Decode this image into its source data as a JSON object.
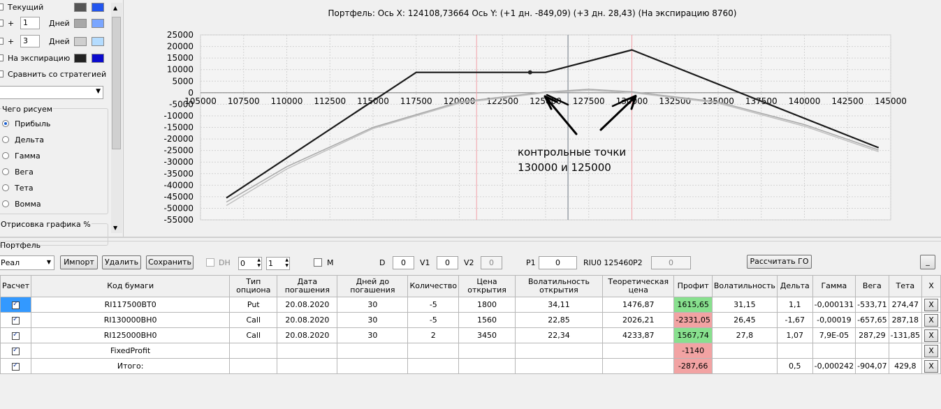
{
  "left_panel": {
    "rows": [
      {
        "label": "Текущий"
      },
      {
        "plus": "+",
        "value": "1",
        "unit": "Дней"
      },
      {
        "plus": "+",
        "value": "3",
        "unit": "Дней"
      },
      {
        "label": "На экспирацию"
      }
    ],
    "compare_label": "Сравнить со стратегией",
    "what_group": "Чего рисуем",
    "options": [
      "Прибыль",
      "Дельта",
      "Гамма",
      "Вега",
      "Тета",
      "Вомма"
    ],
    "selected_option": "Прибыль",
    "draw_group": "Отрисовка графика %",
    "colors": {
      "current_a": "#555555",
      "current_b": "#2255ee",
      "day1_a": "#a8a8a8",
      "day1_b": "#7aa6ff",
      "day3_a": "#cfcfcf",
      "day3_b": "#b4dcff",
      "exp_a": "#222222",
      "exp_b": "#0a0acc"
    }
  },
  "chart": {
    "header": "Портфель: Ось X: 124108,73664 Ось Y:  (+1 дн. -849,09)  (+3 дн. 28,43)  (На экспирацию 8760)",
    "annotation_line1": "контрольные точки",
    "annotation_line2": "130000 и 125000"
  },
  "chart_data": {
    "type": "line",
    "xlim": [
      105000,
      145000
    ],
    "ylim": [
      -55000,
      25000
    ],
    "x_ticks": [
      "105000",
      "107500",
      "110000",
      "112500",
      "115000",
      "117500",
      "120000",
      "122500",
      "125000",
      "127500",
      "130000",
      "132500",
      "135000",
      "137500",
      "140000",
      "142500",
      "145000"
    ],
    "y_ticks": [
      "25000",
      "20000",
      "15000",
      "10000",
      "5000",
      "0",
      "-5000",
      "-10000",
      "-15000",
      "-20000",
      "-25000",
      "-30000",
      "-35000",
      "-40000",
      "-45000",
      "-50000",
      "-55000"
    ],
    "series": [
      {
        "color": "#1a1a1a",
        "x": [
          106500,
          117500,
          124000,
          125000,
          130000,
          144300
        ],
        "y": [
          -45500,
          8800,
          8800,
          8800,
          18500,
          -23800
        ]
      },
      {
        "color": "#c0c0c0",
        "x": [
          106500,
          110000,
          115000,
          120000,
          125000,
          127500,
          130000,
          135000,
          140000,
          144300
        ],
        "y": [
          -48800,
          -33000,
          -15500,
          -4500,
          0,
          1000,
          0,
          -4500,
          -14500,
          -25500
        ]
      },
      {
        "color": "#a8a8a8",
        "x": [
          106500,
          110000,
          115000,
          120000,
          125000,
          127500,
          130000,
          135000,
          140000,
          144300
        ],
        "y": [
          -47300,
          -32000,
          -15000,
          -4000,
          300,
          1500,
          400,
          -4000,
          -13800,
          -24800
        ]
      }
    ],
    "marker": {
      "x": 124100,
      "y": 8800
    },
    "vlines_pink": [
      121000,
      130000
    ],
    "vline_cursor": 126300
  },
  "portfolio": {
    "label": "Портфель",
    "dropdown_value": "Реал",
    "buttons": {
      "import": "Импорт",
      "delete": "Удалить",
      "save": "Сохранить",
      "calc": "Рассчитать ГО",
      "min": "_"
    },
    "dh_label": "DH",
    "spin1": "0",
    "spin2": "1",
    "m_label": "M",
    "d_label": "D",
    "d_value": "0",
    "v1_label": "V1",
    "v1_value": "0",
    "v2_label": "V2",
    "v2_value": "0",
    "p1_label": "P1",
    "p1_value": "0",
    "riu_text": "RIU0 125460",
    "p2_label": "P2",
    "p2_value": "0"
  },
  "table": {
    "headers": [
      "Расчет",
      "Код бумаги",
      "Тип опциона",
      "Дата погашения",
      "Дней до погашения",
      "Количество",
      "Цена открытия",
      "Волатильность открытия",
      "Теоретическая цена",
      "Профит",
      "Волатильность",
      "Дельта",
      "Гамма",
      "Вега",
      "Тета",
      "X"
    ],
    "rows": [
      {
        "code": "RI117500BT0",
        "type": "Put",
        "date": "20.08.2020",
        "days": "30",
        "qty": "-5",
        "open": "1800",
        "vol_open": "34,11",
        "theo": "1476,87",
        "profit": "1615,65",
        "pcls": "g",
        "vol": "31,15",
        "delta": "1,1",
        "gamma": "-0,000131",
        "vega": "-533,71",
        "theta": "274,47",
        "x": "X"
      },
      {
        "code": "RI130000BH0",
        "type": "Call",
        "date": "20.08.2020",
        "days": "30",
        "qty": "-5",
        "open": "1560",
        "vol_open": "22,85",
        "theo": "2026,21",
        "profit": "-2331,05",
        "pcls": "r",
        "vol": "26,45",
        "delta": "-1,67",
        "gamma": "-0,00019",
        "vega": "-657,65",
        "theta": "287,18",
        "x": "X"
      },
      {
        "code": "RI125000BH0",
        "type": "Call",
        "date": "20.08.2020",
        "days": "30",
        "qty": "2",
        "open": "3450",
        "vol_open": "22,34",
        "theo": "4233,87",
        "profit": "1567,74",
        "pcls": "g",
        "vol": "27,8",
        "delta": "1,07",
        "gamma": "7,9E-05",
        "vega": "287,29",
        "theta": "-131,85",
        "x": "X"
      },
      {
        "code": "FixedProfit",
        "type": "",
        "date": "",
        "days": "",
        "qty": "",
        "open": "",
        "vol_open": "",
        "theo": "",
        "profit": "-1140",
        "pcls": "r",
        "vol": "",
        "delta": "",
        "gamma": "",
        "vega": "",
        "theta": "",
        "x": "X"
      },
      {
        "code": "Итого:",
        "type": "",
        "date": "",
        "days": "",
        "qty": "",
        "open": "",
        "vol_open": "",
        "theo": "",
        "profit": "-287,66",
        "pcls": "r",
        "vol": "",
        "delta": "0,5",
        "gamma": "-0,000242",
        "vega": "-904,07",
        "theta": "429,8",
        "x": "X"
      }
    ]
  }
}
